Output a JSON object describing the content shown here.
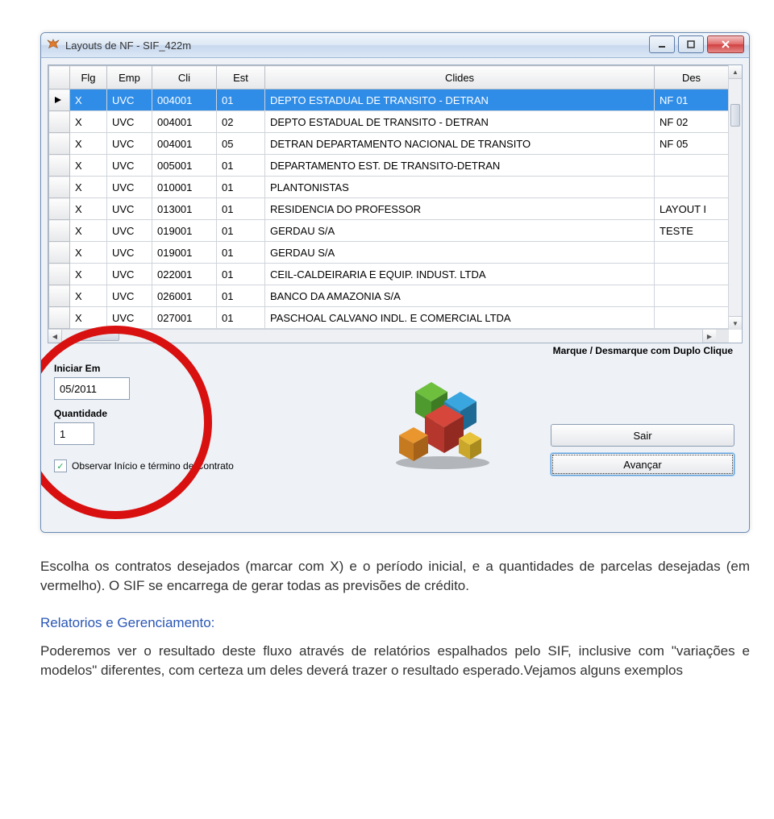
{
  "window": {
    "title": "Layouts de NF  -  SIF_422m"
  },
  "grid": {
    "columns": [
      "Flg",
      "Emp",
      "Cli",
      "Est",
      "Clides",
      "Des"
    ],
    "rows": [
      {
        "flg": "X",
        "emp": "UVC",
        "cli": "004001",
        "est": "01",
        "clides": "DEPTO ESTADUAL DE TRANSITO - DETRAN",
        "des": "NF 01",
        "selected": true
      },
      {
        "flg": "X",
        "emp": "UVC",
        "cli": "004001",
        "est": "02",
        "clides": "DEPTO ESTADUAL DE TRANSITO - DETRAN",
        "des": "NF 02"
      },
      {
        "flg": "X",
        "emp": "UVC",
        "cli": "004001",
        "est": "05",
        "clides": "DETRAN DEPARTAMENTO NACIONAL DE TRANSITO",
        "des": "NF 05"
      },
      {
        "flg": "X",
        "emp": "UVC",
        "cli": "005001",
        "est": "01",
        "clides": "DEPARTAMENTO EST. DE TRANSITO-DETRAN",
        "des": ""
      },
      {
        "flg": "X",
        "emp": "UVC",
        "cli": "010001",
        "est": "01",
        "clides": "PLANTONISTAS",
        "des": ""
      },
      {
        "flg": "X",
        "emp": "UVC",
        "cli": "013001",
        "est": "01",
        "clides": "RESIDENCIA DO PROFESSOR",
        "des": "LAYOUT I"
      },
      {
        "flg": "X",
        "emp": "UVC",
        "cli": "019001",
        "est": "01",
        "clides": "GERDAU S/A",
        "des": "TESTE"
      },
      {
        "flg": "X",
        "emp": "UVC",
        "cli": "019001",
        "est": "01",
        "clides": "GERDAU S/A",
        "des": ""
      },
      {
        "flg": "X",
        "emp": "UVC",
        "cli": "022001",
        "est": "01",
        "clides": "CEIL-CALDEIRARIA E EQUIP. INDUST. LTDA",
        "des": ""
      },
      {
        "flg": "X",
        "emp": "UVC",
        "cli": "026001",
        "est": "01",
        "clides": "BANCO DA AMAZONIA S/A",
        "des": ""
      },
      {
        "flg": "X",
        "emp": "UVC",
        "cli": "027001",
        "est": "01",
        "clides": "PASCHOAL CALVANO INDL. E COMERCIAL LTDA",
        "des": ""
      }
    ]
  },
  "form": {
    "note": "Marque / Desmarque com Duplo Clique",
    "iniciar_label": "Iniciar Em",
    "iniciar_value": "05/2011",
    "quantidade_label": "Quantidade",
    "quantidade_value": "1",
    "checkbox_label": "Observar Início e término de Contrato",
    "checkbox_checked": true,
    "btn_sair": "Sair",
    "btn_avancar": "Avançar"
  },
  "doc": {
    "p1": "Escolha os contratos desejados (marcar com X) e o período inicial, e a quantidades de parcelas desejadas (em vermelho). O SIF se encarrega de gerar todas as previsões de crédito.",
    "h2": "Relatorios e Gerenciamento:",
    "p2": "Poderemos ver o resultado deste fluxo através de relatórios espalhados pelo SIF, inclusive com \"variações e modelos\" diferentes, com certeza um deles deverá trazer o resultado esperado.Vejamos alguns exemplos"
  }
}
